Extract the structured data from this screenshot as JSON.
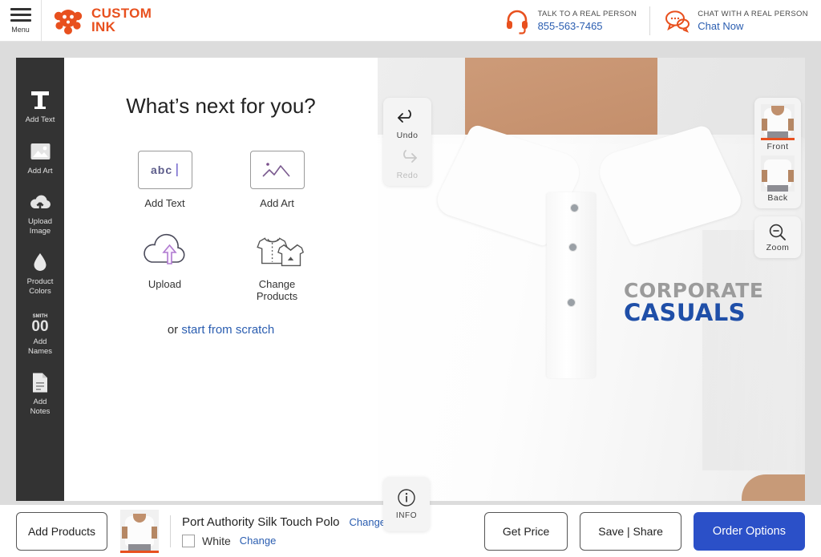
{
  "header": {
    "menu_label": "Menu",
    "brand_line1": "CUSTOM",
    "brand_line2": "INK",
    "brand_color": "#e8501e",
    "support": [
      {
        "icon": "headset-icon",
        "top": "TALK TO A REAL PERSON",
        "bottom": "855-563-7465"
      },
      {
        "icon": "chat-bubble-icon",
        "top": "CHAT WITH A REAL PERSON",
        "bottom": "Chat Now"
      }
    ]
  },
  "toolbar": {
    "items": [
      {
        "icon": "text-t-icon",
        "label": "Add Text"
      },
      {
        "icon": "image-icon",
        "label": "Add Art"
      },
      {
        "icon": "cloud-upload-icon",
        "label": "Upload\nImage"
      },
      {
        "icon": "droplet-icon",
        "label": "Product\nColors"
      },
      {
        "icon": "jersey-number-icon",
        "label": "Add\nNames"
      },
      {
        "icon": "document-icon",
        "label": "Add\nNotes"
      }
    ],
    "names_icon_top": "SMITH",
    "names_icon_bottom": "00"
  },
  "design_panel": {
    "title": "What’s next for you?",
    "options": [
      {
        "icon": "abc-text-icon",
        "label": "Add Text",
        "boxed": true
      },
      {
        "icon": "mountain-art-icon",
        "label": "Add Art",
        "boxed": true
      },
      {
        "icon": "cloud-upload-icon",
        "label": "Upload",
        "boxed": false
      },
      {
        "icon": "two-shirts-icon",
        "label": "Change\nProducts",
        "boxed": false
      }
    ],
    "scratch_prefix": "or ",
    "scratch_link": "start from scratch",
    "abc_glyph": "abc"
  },
  "history": {
    "undo_label": "Undo",
    "redo_label": "Redo",
    "undo_enabled": true,
    "redo_enabled": false
  },
  "info_button": {
    "label": "INFO",
    "icon": "info-circle-icon"
  },
  "views": {
    "items": [
      {
        "label": "Front",
        "active": true
      },
      {
        "label": "Back",
        "active": false
      }
    ],
    "active_color": "#e8501e"
  },
  "zoom_control": {
    "label": "Zoom",
    "icon": "magnifier-minus-icon"
  },
  "artwork": {
    "line1": "CORPORATE",
    "line2": "CASUALS",
    "line1_color": "#9b9b9b",
    "line2_color": "#1f4fa8"
  },
  "bottom_bar": {
    "add_products_label": "Add Products",
    "product_name": "Port Authority Silk Touch Polo",
    "product_change_label": "Change",
    "color_name": "White",
    "color_change_label": "Change",
    "color_hex": "#ffffff",
    "actions": [
      {
        "label": "Get Price",
        "style": "outline"
      },
      {
        "label": "Save | Share",
        "style": "outline"
      },
      {
        "label": "Order Options",
        "style": "primary"
      }
    ],
    "primary_color": "#2b50c8"
  }
}
